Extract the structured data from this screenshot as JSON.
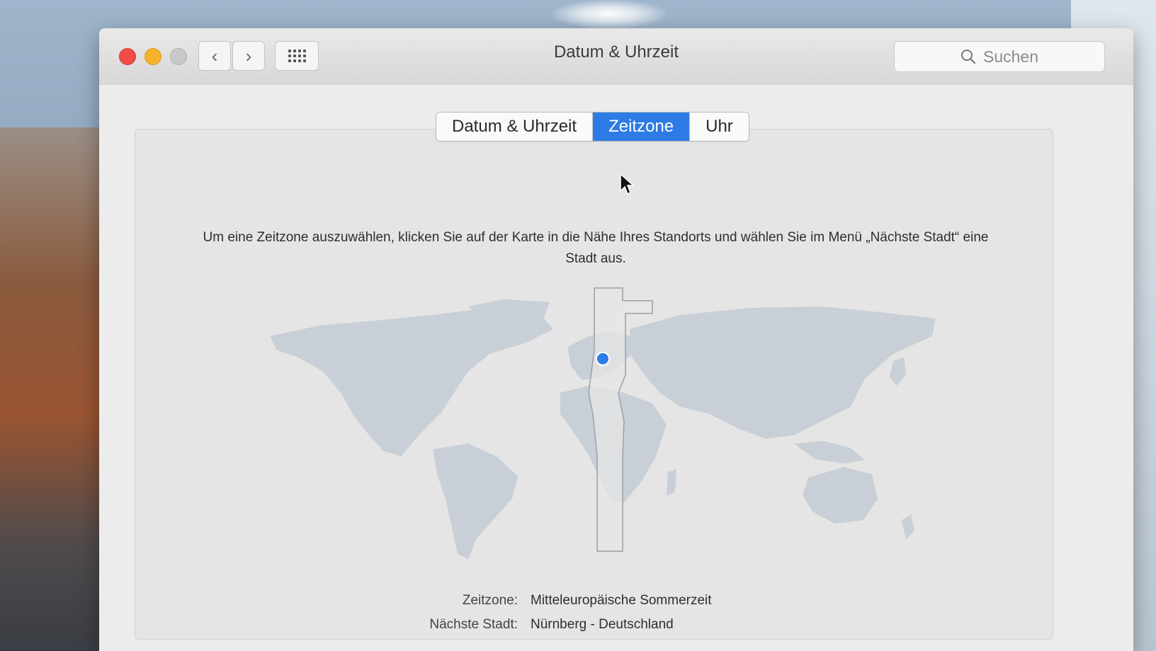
{
  "window": {
    "title": "Datum & Uhrzeit",
    "search_placeholder": "Suchen"
  },
  "nav": {
    "back_glyph": "‹",
    "forward_glyph": "›"
  },
  "tabs": [
    {
      "label": "Datum & Uhrzeit",
      "active": false
    },
    {
      "label": "Zeitzone",
      "active": true
    },
    {
      "label": "Uhr",
      "active": false
    }
  ],
  "instruction": "Um eine Zeitzone auszuwählen, klicken Sie auf der Karte in die Nähe Ihres Standorts und wählen Sie im Menü „Nächste Stadt“ eine Stadt aus.",
  "timezone": {
    "label": "Zeitzone:",
    "value": "Mitteleuropäische Sommerzeit"
  },
  "nearest_city": {
    "label": "Nächste Stadt:",
    "value": "Nürnberg - Deutschland"
  },
  "icons": {
    "search": "search-icon",
    "grid": "grid-icon",
    "location_pin": "location-pin-icon",
    "cursor": "cursor-icon"
  },
  "colors": {
    "accent": "#2e7be6",
    "close": "#f04b48",
    "minimize": "#f6b22d",
    "zoom": "#c8c8c8",
    "land": "#c9cfd6",
    "highlight_band": "#e6e6e6"
  }
}
